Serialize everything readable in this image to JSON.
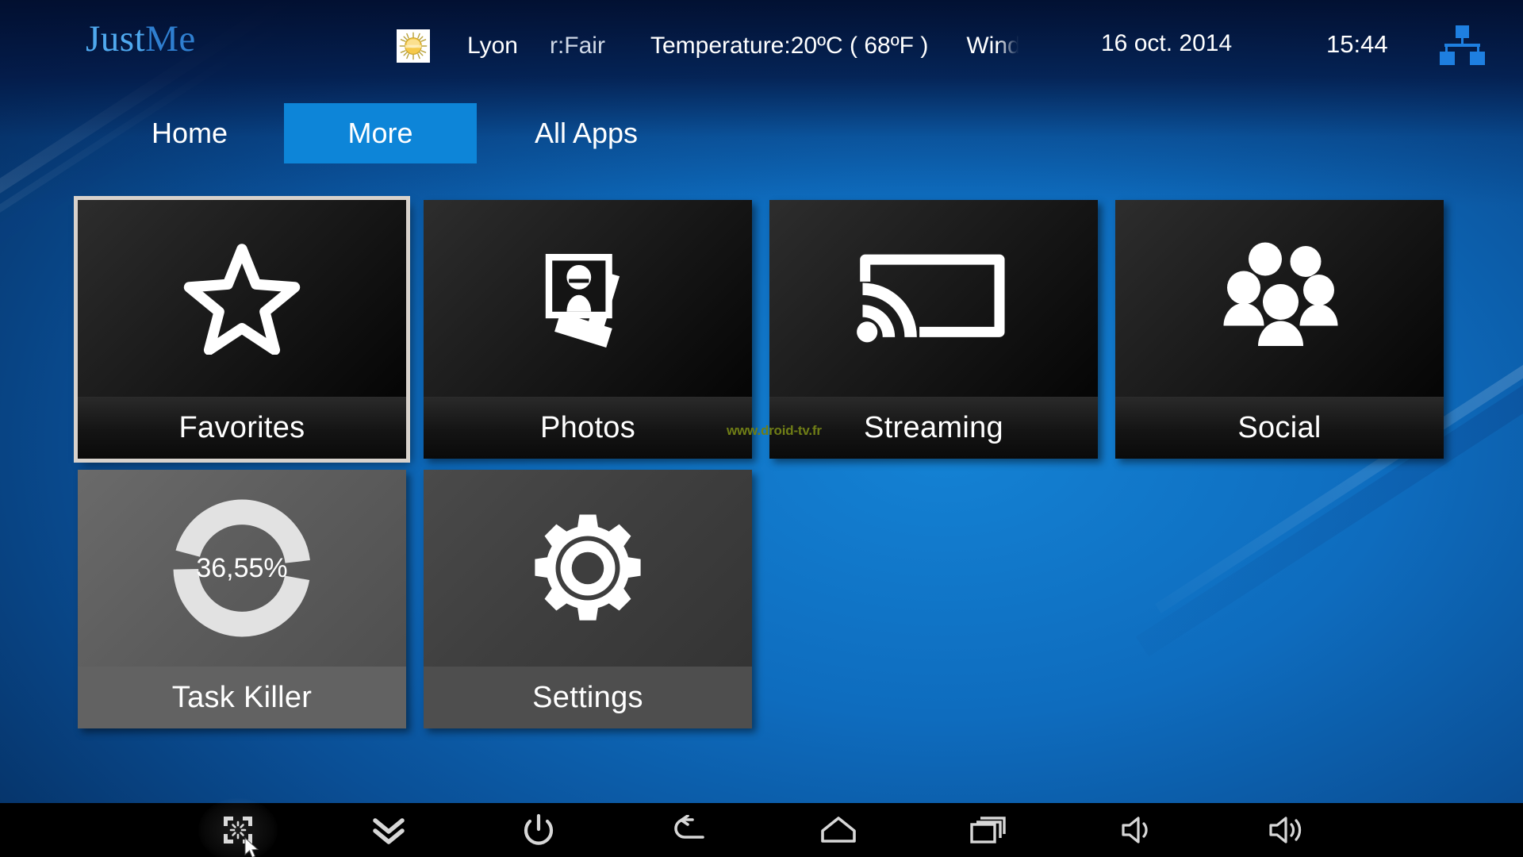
{
  "brand": {
    "part1": "Just",
    "part2": "Me"
  },
  "header": {
    "weather_icon": "sun-icon",
    "city": "Lyon",
    "condition": "r:Fair",
    "temperature": "Temperature:20ºC ( 68ºF )",
    "wind": "Wind",
    "date": "16 oct. 2014",
    "time": "15:44",
    "network_icon": "ethernet-icon"
  },
  "tabs": [
    {
      "label": "Home",
      "active": false
    },
    {
      "label": "More",
      "active": true
    },
    {
      "label": "All Apps",
      "active": false
    }
  ],
  "tiles": [
    {
      "label": "Favorites",
      "icon": "star-icon",
      "theme": "dark",
      "focused": true
    },
    {
      "label": "Photos",
      "icon": "photos-icon",
      "theme": "dark",
      "focused": false
    },
    {
      "label": "Streaming",
      "icon": "cast-icon",
      "theme": "dark",
      "focused": false
    },
    {
      "label": "Social",
      "icon": "people-icon",
      "theme": "dark",
      "focused": false
    },
    {
      "label": "Task Killer",
      "icon": "donut-gauge",
      "theme": "grey",
      "focused": false,
      "value": "36,55%",
      "percent": 36.55
    },
    {
      "label": "Settings",
      "icon": "gear-icon",
      "theme": "grey2",
      "focused": false
    }
  ],
  "watermark": "www.droid-tv.fr",
  "navbar": [
    {
      "name": "screenshot-icon",
      "highlight": true
    },
    {
      "name": "chevron-down-icon",
      "highlight": false
    },
    {
      "name": "power-icon",
      "highlight": false
    },
    {
      "name": "back-icon",
      "highlight": false
    },
    {
      "name": "home-icon",
      "highlight": false
    },
    {
      "name": "recents-icon",
      "highlight": false
    },
    {
      "name": "volume-down-icon",
      "highlight": false
    },
    {
      "name": "volume-up-icon",
      "highlight": false
    }
  ],
  "colors": {
    "accent_blue": "#0d85d8",
    "brand_light": "#4fa9ef",
    "brand_dark": "#2f7fd0",
    "watermark_green": "#6f7d16",
    "focus_border": "#d8d2cc"
  }
}
